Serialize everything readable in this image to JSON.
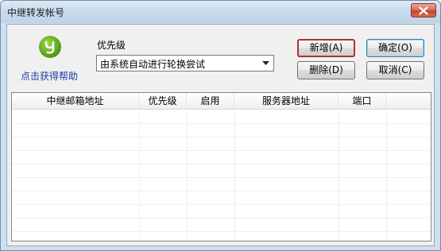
{
  "window": {
    "title": "中继转发帐号"
  },
  "help": {
    "label": "点击获得帮助",
    "icon": "help-logo-icon"
  },
  "priority": {
    "label": "优先级",
    "selected": "由系统自动进行轮换尝试"
  },
  "buttons": {
    "add": "新增(A)",
    "ok": "确定(O)",
    "delete": "删除(D)",
    "cancel": "取消(C)"
  },
  "table": {
    "columns": [
      "中继邮箱地址",
      "优先级",
      "启用",
      "服务器地址",
      "端口"
    ],
    "rows": []
  },
  "colors": {
    "accent_border": "#b0303a",
    "default_button": "#3c7fb1",
    "help_text": "#1a3aa8"
  }
}
